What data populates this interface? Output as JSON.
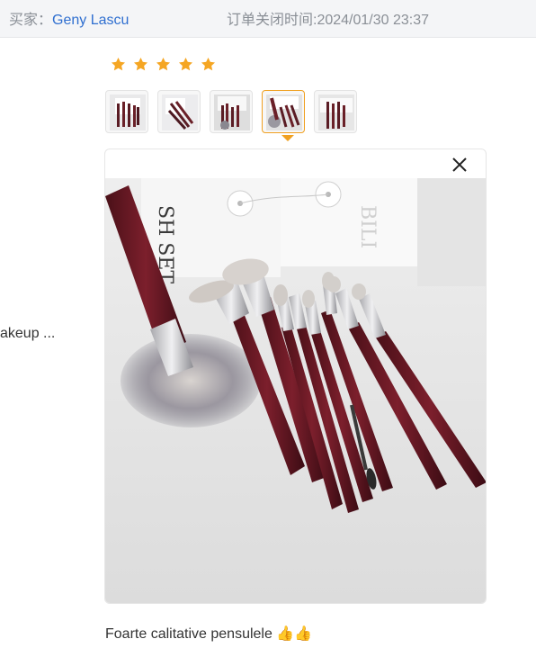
{
  "header": {
    "buyer_label": "买家：",
    "buyer_name": "Geny Lascu",
    "close_time": "订单关闭时间:2024/01/30 23:37"
  },
  "rating": {
    "stars": 5,
    "max": 5,
    "color": "#f5a623"
  },
  "thumbnails": {
    "count": 5,
    "selected_index": 3
  },
  "sidebar": {
    "product_snippet": "akeup ..."
  },
  "review": {
    "text": "Foarte calitative pensulele 👍👍"
  },
  "icons": {
    "close": "close-icon",
    "star": "star-icon"
  },
  "colors": {
    "accent": "#f0a020",
    "link": "#2f6fd0"
  }
}
